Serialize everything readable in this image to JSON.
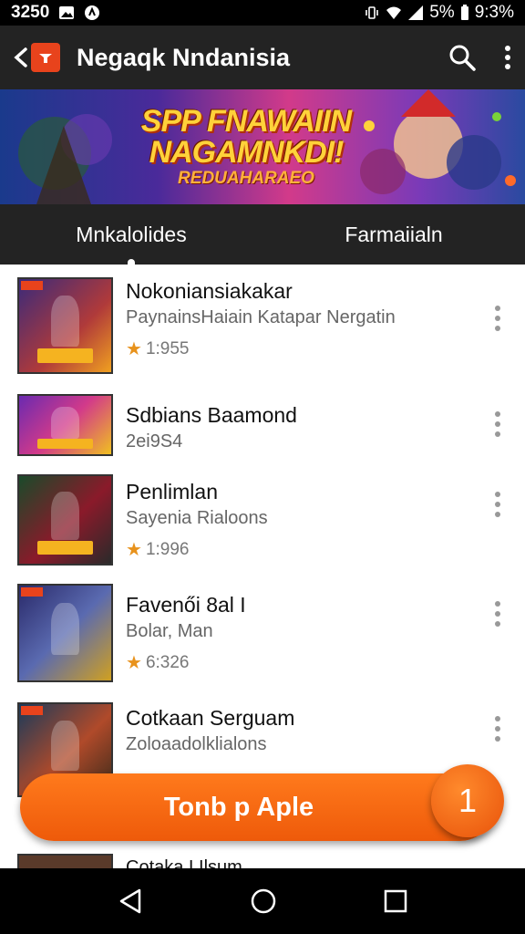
{
  "status_bar": {
    "time_left": "3250",
    "battery": "5%",
    "time_right": "9:3%"
  },
  "toolbar": {
    "title": "Negaqk Nndanisia",
    "icons": [
      "back-arrow-icon",
      "app-logo-icon",
      "search-icon",
      "more-vert-icon"
    ]
  },
  "banner": {
    "line1": "SPP FNAWAIIN",
    "line2": "NAGAMNKDI!",
    "line3": "REDUAHARAEO"
  },
  "tabs": [
    {
      "label": "Mnkalolides"
    },
    {
      "label": "Farmaiialn"
    }
  ],
  "items": [
    {
      "name": "Nokoniansiakakar",
      "subtitle": "PaynainsHaiain Katapar Nergatin",
      "rating": "1:955"
    },
    {
      "name": "Sdbians Baamond",
      "subtitle": "2ei9S4",
      "rating": ""
    },
    {
      "name": "Penlimlan",
      "subtitle": "Sayenia Rialoons",
      "rating": "1:996"
    },
    {
      "name": "Favenői 8al I",
      "subtitle": "Bolar, Man",
      "rating": "6:326"
    },
    {
      "name": "Cotkaan Serguam",
      "subtitle": "Zoloaadolklialons",
      "rating": ""
    }
  ],
  "peek_item": {
    "name": "Cotaka I Ilsum"
  },
  "cta": {
    "label": "Tonb p Aple"
  },
  "fab": {
    "label": "1"
  },
  "colors": {
    "accent": "#ee5a0a",
    "toolbar": "#232323",
    "star": "#e8921c"
  }
}
